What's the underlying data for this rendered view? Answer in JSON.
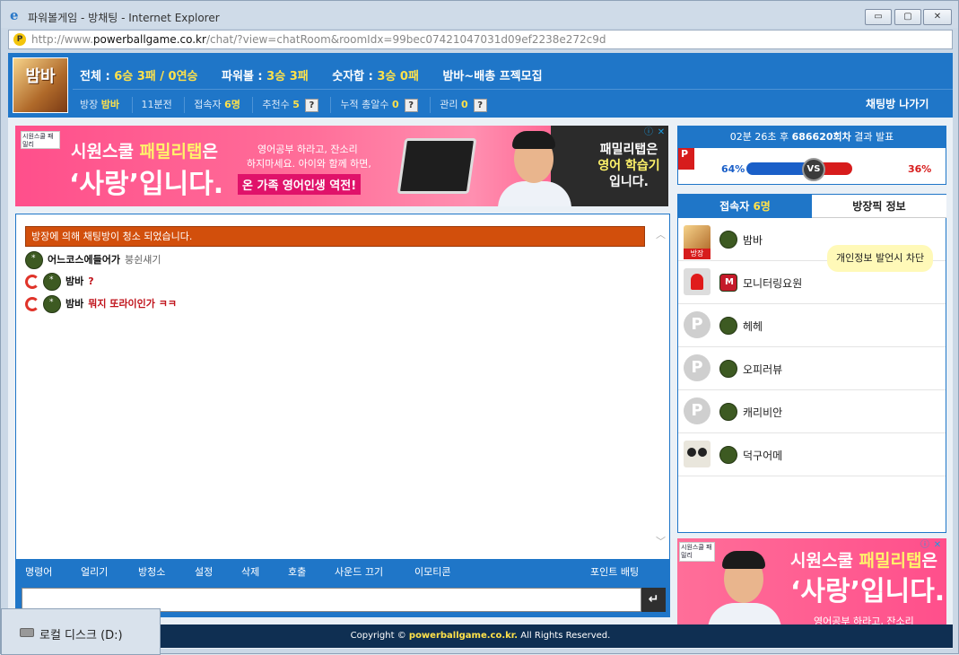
{
  "window": {
    "title": "파워볼게임 - 방채팅 - Internet Explorer",
    "min": "▭",
    "max": "▢",
    "close": "✕"
  },
  "address": {
    "prefix": "http://www.",
    "domain": "powerballgame.co.kr",
    "path": "/chat/?view=chatRoom&roomIdx=99bec07421047031d09ef2238e272c9d"
  },
  "room": {
    "thumb_text": "밤바",
    "stats": [
      {
        "label": "전체 :",
        "value": "6승 3패 / 0연승"
      },
      {
        "label": "파워볼 :",
        "value": "3승 3패"
      },
      {
        "label": "숫자합 :",
        "value": "3승 0패"
      },
      {
        "label": "밤바~배총 프젝모집",
        "value": ""
      }
    ],
    "owner_label": "방장",
    "owner_name": "밤바",
    "elapsed": "11분전",
    "visitors_label": "접속자",
    "visitors_value": "6명",
    "recommend_label": "추천수",
    "recommend_value": "5",
    "betting_label": "누적 총알수",
    "betting_value": "0",
    "manage_label": "관리",
    "manage_value": "0",
    "help": "?",
    "exit_label": "채팅방 나가기"
  },
  "ad_top": {
    "logo": "시원스쿨 패밀리",
    "headline_a": "시원스쿨 ",
    "headline_b": "패밀리탭",
    "headline_c": "은",
    "headline2": "‘사랑’입니다.",
    "msg1": "영어공부 하라고, 잔소리",
    "msg2": "하지마세요. 아이와 함께 하면,",
    "msg3": "온 가족 영어인생 역전!",
    "right_a": "패밀리탭은",
    "right_b": "영어 학습기",
    "right_c": "입니다.",
    "info": "ⓘ",
    "close": "✕"
  },
  "chat": {
    "notice": "방장에 의해 채팅방이 청소 되었습니다.",
    "messages": [
      {
        "nick": "어느코스에들어가",
        "text": "붕쉰섀기"
      },
      {
        "nick": "밤바",
        "text": "?"
      },
      {
        "nick": "밤바",
        "text": "뭐지 또라이인가 ㅋㅋ"
      }
    ],
    "scroll_up": "︿",
    "scroll_down": "﹀",
    "commands": [
      "명령어",
      "얼리기",
      "방청소",
      "설정",
      "삭제",
      "호출",
      "사운드 끄기",
      "이모티콘"
    ],
    "point_bet": "포인트 배팅",
    "send": "↵"
  },
  "result": {
    "header_time": "02분 26초 후",
    "header_round": "686620회차",
    "header_tail": "결과 발표",
    "p": "P",
    "left_pct": "64%",
    "right_pct": "36%",
    "vs": "VS",
    "left_value": 64,
    "right_value": 36
  },
  "users": {
    "tab_users_label": "접속자",
    "tab_users_count": "6명",
    "tab_info": "방장픽 정보",
    "room_tag": "방장",
    "list": [
      {
        "name": "밤바",
        "avatar": "room-thumb"
      },
      {
        "name": "모니터링요원",
        "avatar": "monitor-siren-icon"
      },
      {
        "name": "헤헤",
        "avatar": "p-icon"
      },
      {
        "name": "오피러뷰",
        "avatar": "p-icon"
      },
      {
        "name": "캐리비안",
        "avatar": "p-icon"
      },
      {
        "name": "덕구어메",
        "avatar": "duck-photo"
      }
    ],
    "monitor_tip": "개인정보 발언시 차단",
    "p_letter": "P"
  },
  "ad_side": {
    "logo": "시원스쿨 패밀리",
    "headline_a": "시원스쿨 ",
    "headline_b": "패밀리탭",
    "headline_c": "은",
    "headline2": "‘사랑’입니다.",
    "msg1": "영어공부 하라고, 잔소리",
    "info": "ⓘ",
    "close": "✕"
  },
  "footer": {
    "pre": "Copyright © ",
    "domain": "powerballgame.co.kr.",
    "post": " All Rights Reserved."
  },
  "taskbar": {
    "label": "로컬 디스크 (D:)"
  },
  "colors": {
    "accent": "#1f76c8",
    "notice": "#d24f0c",
    "highlight": "#ffe24a",
    "odd_red": "#d71c1c",
    "even_blue": "#1a5fc8"
  }
}
